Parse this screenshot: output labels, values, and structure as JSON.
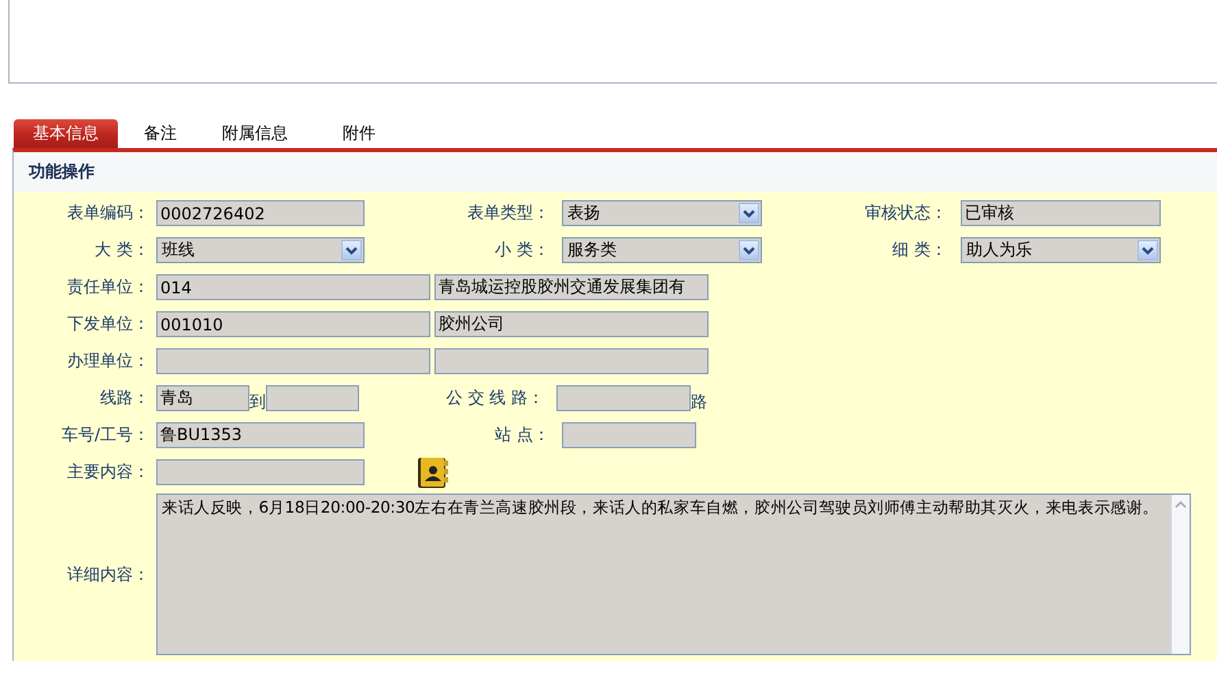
{
  "tabs": [
    {
      "label": "基本信息",
      "selected": true
    },
    {
      "label": "备注",
      "selected": false
    },
    {
      "label": "附属信息",
      "selected": false
    },
    {
      "label": "附件",
      "selected": false
    }
  ],
  "section_title": "功能操作",
  "rows": [
    {
      "cells": [
        {
          "label": "表单编码：",
          "kind": "text",
          "value": "0002726402"
        },
        {
          "label": "表单类型：",
          "kind": "select",
          "value": "表扬"
        },
        {
          "label": "审核状态：",
          "kind": "text",
          "value": "已审核"
        }
      ]
    },
    {
      "cells": [
        {
          "label": "大 类：",
          "kind": "select",
          "value": "班线"
        },
        {
          "label": "小 类：",
          "kind": "select",
          "value": "服务类"
        },
        {
          "label": "细 类：",
          "kind": "select",
          "value": "助人为乐"
        }
      ]
    },
    {
      "cells": [
        {
          "label": "责任单位：",
          "kind": "pair",
          "value": "014",
          "value2": "青岛城运控股胶州交通发展集团有"
        }
      ]
    },
    {
      "cells": [
        {
          "label": "下发单位：",
          "kind": "pair",
          "value": "001010",
          "value2": "胶州公司"
        }
      ]
    },
    {
      "cells": [
        {
          "label": "办理单位：",
          "kind": "pair"
        }
      ]
    },
    {
      "cells": [
        {
          "label": "线路：",
          "kind": "range",
          "value": "青岛",
          "joiner": "到"
        },
        {
          "label": "公 交 线 路：",
          "kind": "text",
          "suffix": "路"
        }
      ]
    },
    {
      "cells": [
        {
          "label": "车号/工号：",
          "kind": "text",
          "value": "鲁BU1353"
        },
        {
          "label": "站 点：",
          "kind": "text"
        }
      ]
    },
    {
      "cells": [
        {
          "label": "主要内容：",
          "kind": "lookup"
        }
      ]
    }
  ],
  "details": {
    "label": "详细内容：",
    "value": "来话人反映，6月18日20:00-20:30左右在青兰高速胶州段，来话人的私家车自燃，胶州公司驾驶员刘师傅主动帮助其灭火，来电表示感谢。"
  }
}
